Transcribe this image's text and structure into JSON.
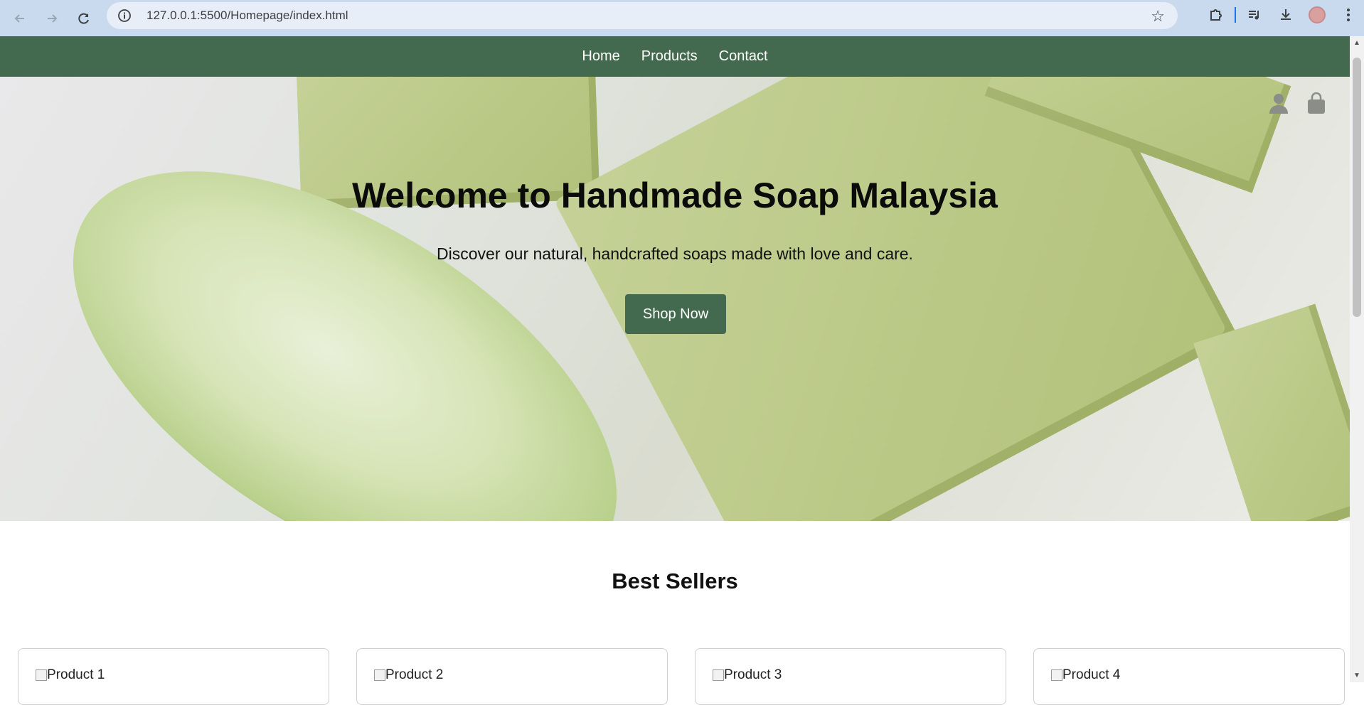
{
  "browser": {
    "url": "127.0.0.1:5500/Homepage/index.html",
    "icons": {
      "back": "arrow-left-icon",
      "forward": "arrow-right-icon",
      "reload": "reload-icon",
      "site_info": "info-icon",
      "bookmark": "star-icon",
      "extensions": "puzzle-icon",
      "media": "media-queue-icon",
      "downloads": "download-icon",
      "profile": "avatar",
      "menu": "kebab-menu-icon"
    }
  },
  "nav": {
    "items": [
      {
        "label": "Home"
      },
      {
        "label": "Products"
      },
      {
        "label": "Contact"
      }
    ],
    "bg_color": "#436a4f"
  },
  "hero": {
    "title": "Welcome to Handmade Soap Malaysia",
    "subtitle": "Discover our natural, handcrafted soaps made with love and care.",
    "button_label": "Shop Now",
    "icons": {
      "account": "user-icon",
      "cart": "shopping-bag-icon"
    }
  },
  "best_sellers": {
    "title": "Best Sellers",
    "products": [
      {
        "alt": "Product 1"
      },
      {
        "alt": "Product 2"
      },
      {
        "alt": "Product 3"
      },
      {
        "alt": "Product 4"
      }
    ]
  },
  "colors": {
    "accent": "#436a4f",
    "browser_bar": "#c9d9ee"
  }
}
